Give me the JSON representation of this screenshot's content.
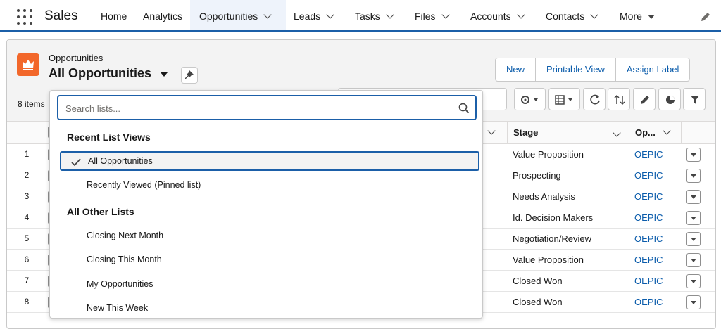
{
  "app": {
    "name": "Sales"
  },
  "nav": {
    "items": [
      {
        "label": "Home",
        "dropdown": false,
        "active": false
      },
      {
        "label": "Analytics",
        "dropdown": false,
        "active": false
      },
      {
        "label": "Opportunities",
        "dropdown": true,
        "active": true
      },
      {
        "label": "Leads",
        "dropdown": true,
        "active": false
      },
      {
        "label": "Tasks",
        "dropdown": true,
        "active": false
      },
      {
        "label": "Files",
        "dropdown": true,
        "active": false
      },
      {
        "label": "Accounts",
        "dropdown": true,
        "active": false
      },
      {
        "label": "Contacts",
        "dropdown": true,
        "active": false
      },
      {
        "label": "More",
        "dropdown": true,
        "active": false
      }
    ]
  },
  "header": {
    "object_label": "Opportunities",
    "list_title": "All Opportunities",
    "items_count": "8 items",
    "buttons": {
      "new": "New",
      "printable": "Printable View",
      "assign": "Assign Label"
    }
  },
  "table": {
    "columns": {
      "stage": "Stage",
      "opp": "Op..."
    },
    "rows": [
      {
        "num": "1",
        "stage": "Value Proposition",
        "opp": "OEPIC"
      },
      {
        "num": "2",
        "stage": "Prospecting",
        "opp": "OEPIC"
      },
      {
        "num": "3",
        "stage": "Needs Analysis",
        "opp": "OEPIC"
      },
      {
        "num": "4",
        "stage": "Id. Decision Makers",
        "opp": "OEPIC"
      },
      {
        "num": "5",
        "stage": "Negotiation/Review",
        "opp": "OEPIC"
      },
      {
        "num": "6",
        "stage": "Value Proposition",
        "opp": "OEPIC"
      },
      {
        "num": "7",
        "stage": "Closed Won",
        "opp": "OEPIC"
      },
      {
        "num": "8",
        "stage": "Closed Won",
        "opp": "OEPIC"
      }
    ]
  },
  "dropdown": {
    "search_placeholder": "Search lists...",
    "recent_heading": "Recent List Views",
    "recent_items": [
      "All Opportunities",
      "Recently Viewed (Pinned list)"
    ],
    "other_heading": "All Other Lists",
    "other_items": [
      "Closing Next Month",
      "Closing This Month",
      "My Opportunities",
      "New This Week"
    ]
  },
  "colors": {
    "brand_blue": "#1b5fa8",
    "link_blue": "#0b5cab",
    "object_orange": "#f2672a"
  }
}
